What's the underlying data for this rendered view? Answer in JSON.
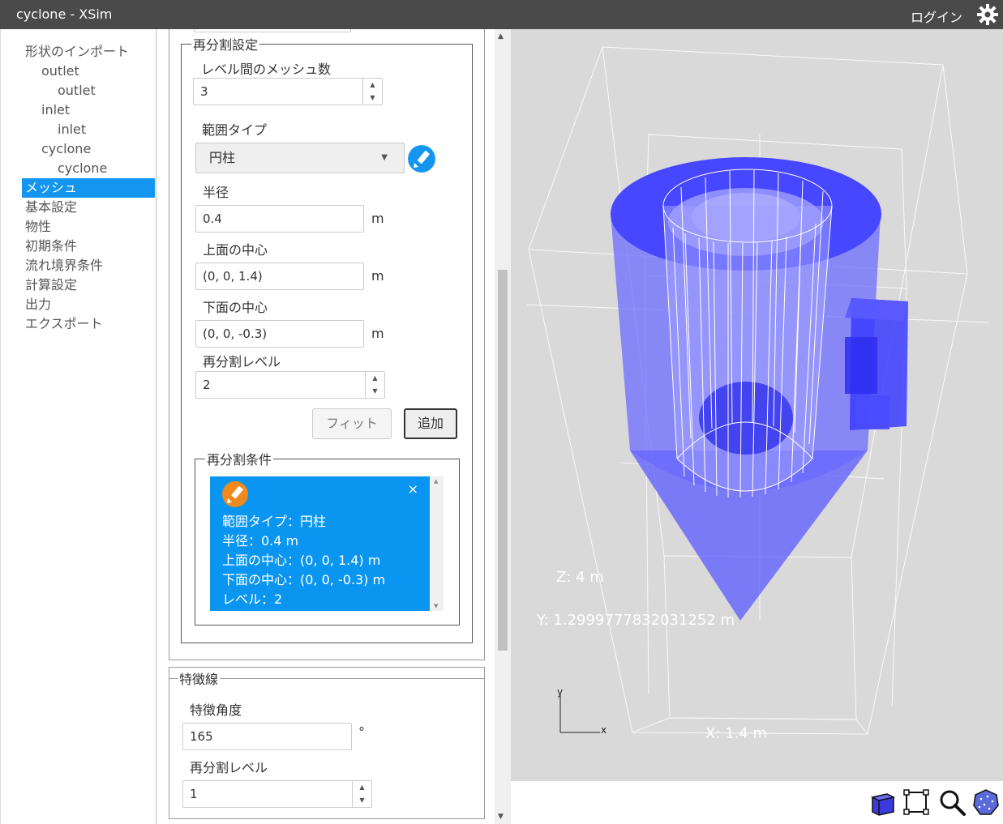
{
  "app": {
    "title": "cyclone - XSim",
    "login_label": "ログイン",
    "settings_icon": "gear-icon"
  },
  "sidebar": {
    "items": [
      {
        "label": "形状のインポート",
        "level": 0
      },
      {
        "label": "outlet",
        "level": 1
      },
      {
        "label": "outlet",
        "level": 2
      },
      {
        "label": "inlet",
        "level": 1
      },
      {
        "label": "inlet",
        "level": 2
      },
      {
        "label": "cyclone",
        "level": 1
      },
      {
        "label": "cyclone",
        "level": 2
      },
      {
        "label": "メッシュ",
        "level": 0,
        "selected": true
      },
      {
        "label": "基本設定",
        "level": 0
      },
      {
        "label": "物性",
        "level": 0
      },
      {
        "label": "初期条件",
        "level": 0
      },
      {
        "label": "流れ境界条件",
        "level": 0
      },
      {
        "label": "計算設定",
        "level": 0
      },
      {
        "label": "出力",
        "level": 0
      },
      {
        "label": "エクスポート",
        "level": 0
      }
    ]
  },
  "refine": {
    "legend": "再分割設定",
    "mesh_between_levels_label": "レベル間のメッシュ数",
    "mesh_between_levels_value": "3",
    "range_type_label": "範囲タイプ",
    "range_type_value": "円柱",
    "radius_label": "半径",
    "radius_value": "0.4",
    "radius_unit": "m",
    "top_center_label": "上面の中心",
    "top_center_value": "(0, 0, 1.4)",
    "top_center_unit": "m",
    "bottom_center_label": "下面の中心",
    "bottom_center_value": "(0, 0, -0.3)",
    "bottom_center_unit": "m",
    "level_label": "再分割レベル",
    "level_value": "2",
    "fit_label": "フィット",
    "add_label": "追加"
  },
  "conditions": {
    "legend": "再分割条件",
    "item": {
      "close": "×",
      "lines": [
        "範囲タイプ：円柱",
        "半径：0.4 m",
        "上面の中心：(0, 0, 1.4) m",
        "下面の中心：(0, 0, -0.3) m",
        "レベル：2"
      ]
    }
  },
  "feature": {
    "legend": "特徴線",
    "angle_label": "特徴角度",
    "angle_value": "165",
    "angle_unit": "°",
    "level_label": "再分割レベル",
    "level_value": "1"
  },
  "viewer": {
    "z_label": "Z: 4 m",
    "y_label": "Y: 1.2999777832031252 m",
    "x_label": "X: 1.4 m",
    "axis_y": "y",
    "axis_x": "x",
    "colors": {
      "background": "#d9d9d9",
      "body": "#5050ff",
      "wire": "#ffffff"
    }
  },
  "toolbar": {
    "tools": [
      "cube-view-icon",
      "fit-bounds-icon",
      "zoom-icon",
      "mesh-sphere-icon"
    ]
  }
}
